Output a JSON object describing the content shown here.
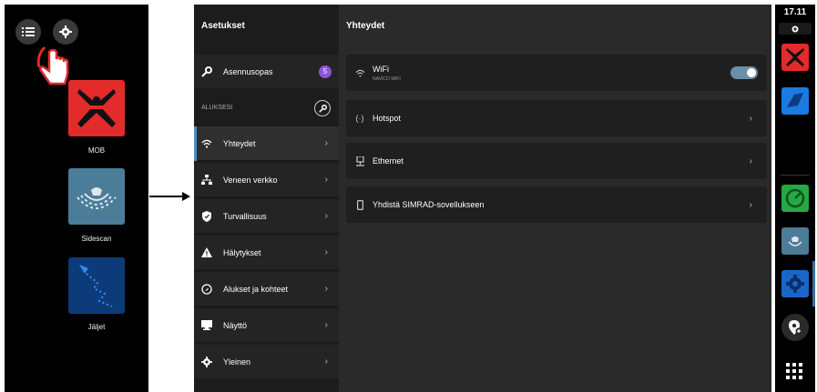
{
  "left_panel": {
    "apps": [
      {
        "label": "MOB",
        "icon": "mob-icon",
        "color": "#e22b2b"
      },
      {
        "label": "Sidescan",
        "icon": "sidescan-icon",
        "color": "#4b7d99"
      },
      {
        "label": "Jäljet",
        "icon": "trails-icon",
        "color": "#0d3b7a"
      }
    ]
  },
  "settings": {
    "title": "Asetukset",
    "installation_guide": {
      "label": "Asennusopas",
      "badge": "5"
    },
    "section_label": "ALUKSESI",
    "items": [
      {
        "label": "Yhteydet"
      },
      {
        "label": "Veneen verkko"
      },
      {
        "label": "Turvallisuus"
      },
      {
        "label": "Hälytykset"
      },
      {
        "label": "Alukset ja kohteet"
      },
      {
        "label": "Näyttö"
      },
      {
        "label": "Yleinen"
      }
    ]
  },
  "connections": {
    "title": "Yhteydet",
    "rows": [
      {
        "label": "WiFi",
        "sublabel": "NAVICO WIFI",
        "toggle_on": true
      },
      {
        "label": "Hotspot"
      },
      {
        "label": "Ethernet"
      },
      {
        "label": "Yhdistä SIMRAD-sovellukseen"
      }
    ]
  },
  "rail": {
    "time": "17.11"
  },
  "colors": {
    "accent": "#4a90c0",
    "badge": "#8a55d8",
    "mob_red": "#e22b2b",
    "green": "#27a843",
    "blue": "#1a7be0"
  }
}
